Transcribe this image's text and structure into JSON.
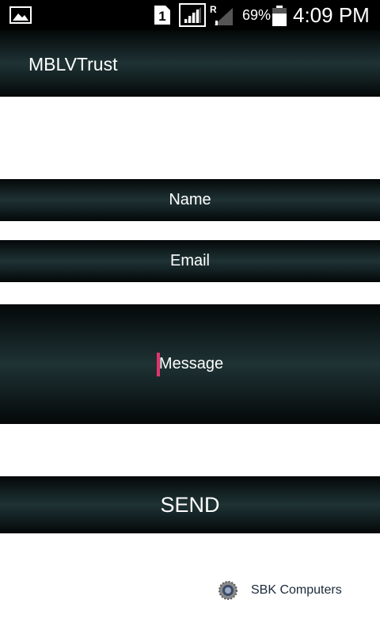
{
  "status_bar": {
    "sim_number": "1",
    "roaming_label": "R",
    "battery_percent": "69%",
    "battery_level": 0.69,
    "time": "4:09 PM"
  },
  "app": {
    "title": "MBLVTrust"
  },
  "form": {
    "name_placeholder": "Name",
    "email_placeholder": "Email",
    "message_placeholder": "Message",
    "send_label": "SEND"
  },
  "footer": {
    "text": "SBK Computers",
    "logo_icon": "sbk-logo-icon"
  },
  "colors": {
    "bar_dark": "#040707",
    "bar_mid": "#1f3234",
    "cursor": "#e0356f",
    "background": "#ffffff"
  }
}
